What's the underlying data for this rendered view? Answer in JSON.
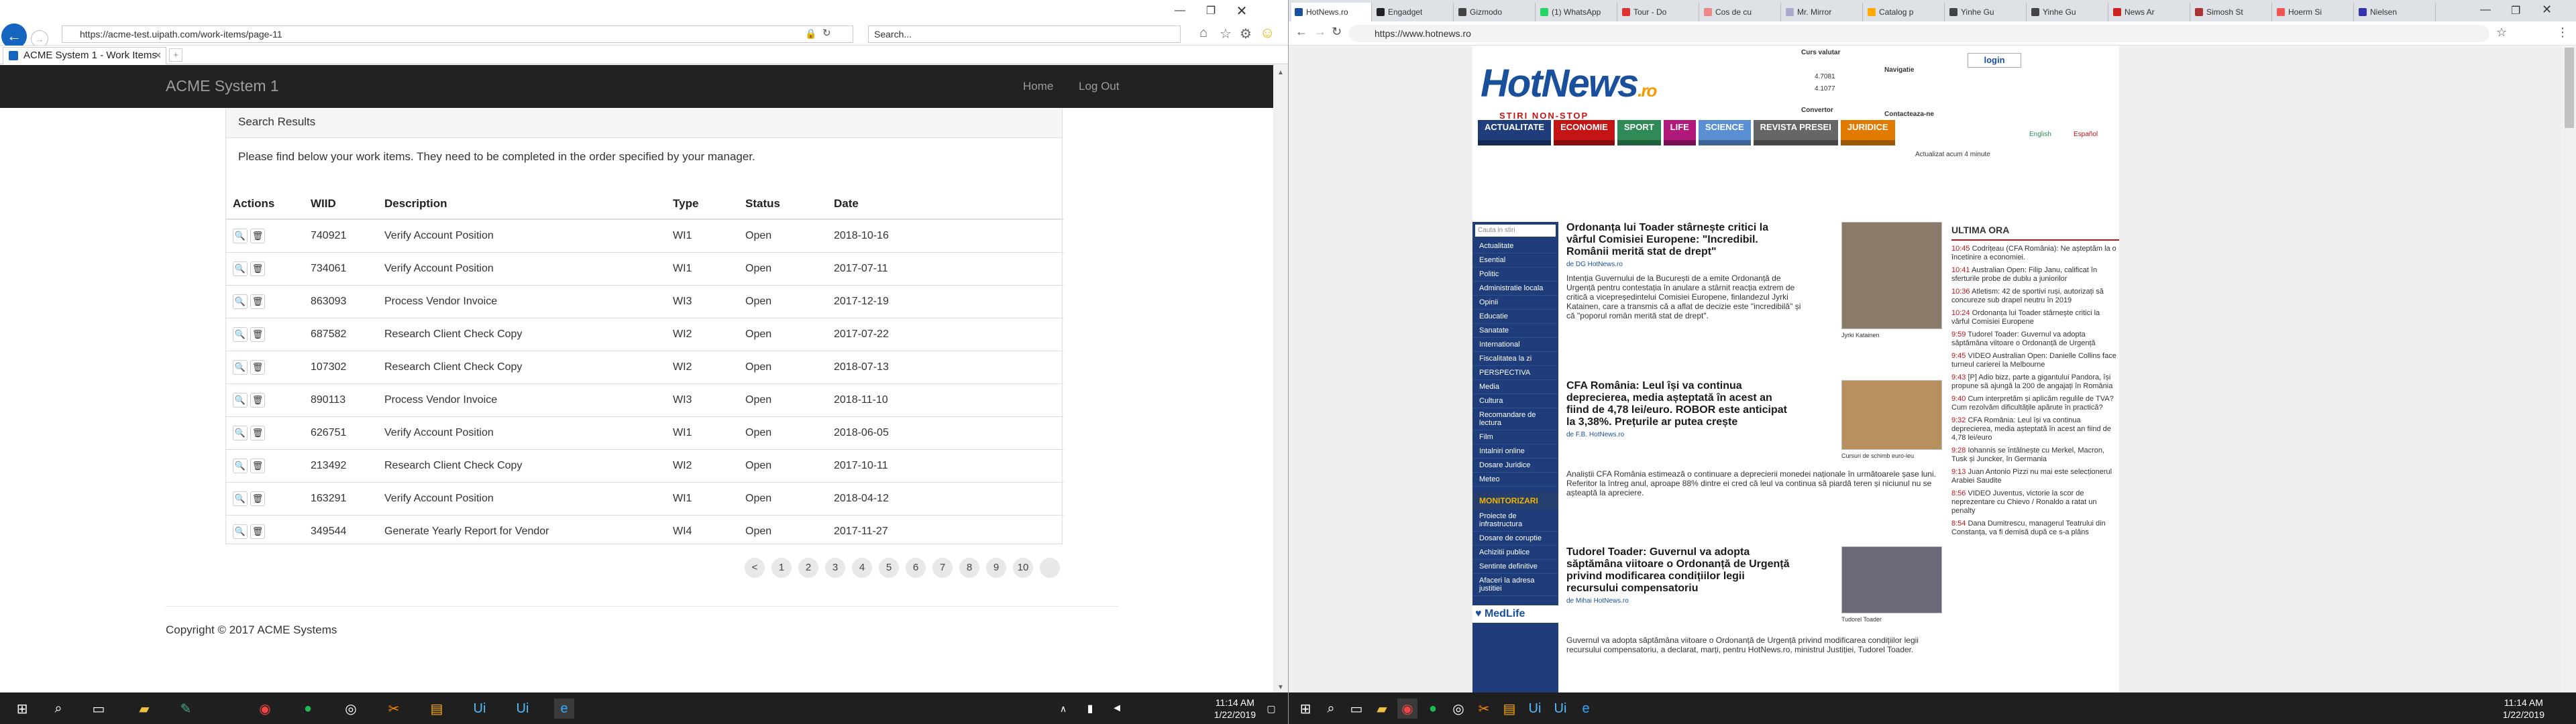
{
  "ie": {
    "url": "https://acme-test.uipath.com/work-items/page-11",
    "search_placeholder": "Search...",
    "tab_title": "ACME System 1 - Work Items",
    "app": {
      "brand": "ACME System 1",
      "nav_home": "Home",
      "nav_logout": "Log Out",
      "panel_title": "Search Results",
      "panel_message": "Please find below your work items. They need to be completed in the order specified by your manager.",
      "columns": [
        "Actions",
        "WIID",
        "Description",
        "Type",
        "Status",
        "Date"
      ],
      "rows": [
        {
          "wiid": "740921",
          "desc": "Verify Account Position",
          "type": "WI1",
          "status": "Open",
          "date": "2018-10-16"
        },
        {
          "wiid": "734061",
          "desc": "Verify Account Position",
          "type": "WI1",
          "status": "Open",
          "date": "2017-07-11"
        },
        {
          "wiid": "863093",
          "desc": "Process Vendor Invoice",
          "type": "WI3",
          "status": "Open",
          "date": "2017-12-19"
        },
        {
          "wiid": "687582",
          "desc": "Research Client Check Copy",
          "type": "WI2",
          "status": "Open",
          "date": "2017-07-22"
        },
        {
          "wiid": "107302",
          "desc": "Research Client Check Copy",
          "type": "WI2",
          "status": "Open",
          "date": "2018-07-13"
        },
        {
          "wiid": "890113",
          "desc": "Process Vendor Invoice",
          "type": "WI3",
          "status": "Open",
          "date": "2018-11-10"
        },
        {
          "wiid": "626751",
          "desc": "Verify Account Position",
          "type": "WI1",
          "status": "Open",
          "date": "2018-06-05"
        },
        {
          "wiid": "213492",
          "desc": "Research Client Check Copy",
          "type": "WI2",
          "status": "Open",
          "date": "2017-10-11"
        },
        {
          "wiid": "163291",
          "desc": "Verify Account Position",
          "type": "WI1",
          "status": "Open",
          "date": "2018-04-12"
        },
        {
          "wiid": "349544",
          "desc": "Generate Yearly Report for Vendor",
          "type": "WI4",
          "status": "Open",
          "date": "2017-11-27"
        }
      ],
      "pages": [
        "<",
        "1",
        "2",
        "3",
        "4",
        "5",
        "6",
        "7",
        "8",
        "9",
        "10",
        ""
      ],
      "footer": "Copyright © 2017 ACME Systems"
    },
    "clock": {
      "time": "11:14 AM",
      "date": "1/22/2019"
    }
  },
  "chrome": {
    "tabs": [
      {
        "label": "HotNews.ro",
        "color": "#1a4f9c"
      },
      {
        "label": "Engadget",
        "color": "#222"
      },
      {
        "label": "Gizmodo",
        "color": "#444"
      },
      {
        "label": "(1) WhatsApp",
        "color": "#25d366"
      },
      {
        "label": "Tour - Do",
        "color": "#d33"
      },
      {
        "label": "Cos de cu",
        "color": "#e88"
      },
      {
        "label": "Mr. Mirror",
        "color": "#aac"
      },
      {
        "label": "Catalog p",
        "color": "#fa0"
      },
      {
        "label": "Yinhe Gu",
        "color": "#444"
      },
      {
        "label": "Yinhe Gu",
        "color": "#444"
      },
      {
        "label": "News Ar",
        "color": "#c22"
      },
      {
        "label": "Simosh St",
        "color": "#a33"
      },
      {
        "label": "Hoerm Si",
        "color": "#e55"
      },
      {
        "label": "Nielsen",
        "color": "#33a"
      }
    ],
    "url": "https://www.hotnews.ro",
    "hotnews": {
      "logo_main": "HotNews",
      "logo_suffix": ".ro",
      "slogan": "STIRI NON-STOP",
      "curs_label": "Curs valutar",
      "rates": [
        "4.7081",
        "4.1077"
      ],
      "convertor": "Convertor",
      "login": "login",
      "navigatie": "Navigatie",
      "contact": "Contacteaza-ne",
      "nav": [
        {
          "label": "ACTUALITATE",
          "color": "#1e3d7a"
        },
        {
          "label": "ECONOMIE",
          "color": "#c41414"
        },
        {
          "label": "SPORT",
          "color": "#2e8b57"
        },
        {
          "label": "LIFE",
          "color": "#b0187a"
        },
        {
          "label": "SCIENCE",
          "color": "#5b8fd4"
        },
        {
          "label": "REVISTA PRESEI",
          "color": "#666"
        },
        {
          "label": "JURIDICE",
          "color": "#e07b00"
        }
      ],
      "lang_en": "English",
      "lang_es": "Español",
      "updated": "Actualizat acum 4 minute",
      "side_search": "Cauta in stiri",
      "side_items": [
        "Actualitate",
        "Esential",
        "Politic",
        "Administratie locala",
        "Opinii",
        "Educatie",
        "Sanatate",
        "International",
        "Fiscalitatea la zi",
        "PERSPECTIVA",
        "Media",
        "Cultura",
        "Recomandare de lectura",
        "Film",
        "Intalniri online",
        "Dosare Juridice",
        "Meteo"
      ],
      "side_head": "MONITORIZARI",
      "side_items2": [
        "Proiecte de infrastructura",
        "Dosare de coruptie",
        "Achizitii publice",
        "Sentinte definitive",
        "Afaceri la adresa justitiei"
      ],
      "medlife": "MedLife",
      "articles": [
        {
          "title": "Ordonanța lui Toader stârnește critici la vârful Comisiei Europene: \"Incredibil. Românii merită stat de drept\"",
          "meta": "de DG HotNews.ro",
          "text": "Intenția Guvernului de la București de a emite Ordonanță de Urgență pentru contestația în anulare a stârnit reacția extrem de critică a vicepreședintelui Comisiei Europene, finlandezul Jyrki Katainen, care a transmis că a aflat de decizie este \"incredibilă\" și că \"poporul român merită stat de drept\".",
          "caption": "Jyrki Katainen"
        },
        {
          "title": "CFA România: Leul își va continua deprecierea, media așteptată în acest an fiind de 4,78 lei/euro. ROBOR este anticipat la 3,38%. Prețurile ar putea crește",
          "meta": "de F.B. HotNews.ro",
          "text": "Analiștii CFA România estimează o continuare a deprecierii monedei naționale în următoarele șase luni. Referitor la întreg anul, aproape 88% dintre ei cred că leul va continua să piardă teren și niciunul nu se așteaptă la apreciere.",
          "caption": "Cursuri de schimb euro-leu"
        },
        {
          "title": "Tudorel Toader: Guvernul va adopta săptămâna viitoare o Ordonanță de Urgență privind modificarea condițiilor legii recursului compensatoriu",
          "meta": "de Mihai HotNews.ro",
          "text": "Guvernul va adopta săptămâna viitoare o Ordonanță de Urgență privind modificarea condițiilor legii recursului compensatoriu, a declarat, marți, pentru HotNews.ro, ministrul Justiției, Tudorel Toader.",
          "caption": "Tudorel Toader"
        }
      ],
      "ultima_ora": "ULTIMA ORA",
      "news": [
        {
          "time": "10:45",
          "text": "Codrițeau (CFA România): Ne așteptăm la o încetinire a economiei."
        },
        {
          "time": "10:41",
          "text": "Australian Open: Filip Janu, calificat în sferturile probe de dublu a juniorilor"
        },
        {
          "time": "10:36",
          "text": "Atletism: 42 de sportivi ruși, autorizați să concureze sub drapel neutru în 2019"
        },
        {
          "time": "10:24",
          "text": "Ordonanța lui Toader stârnește critici la vârful Comisiei Europene"
        },
        {
          "time": "9:59",
          "text": "Tudorel Toader: Guvernul va adopta săptămâna viitoare o Ordonanță de Urgență"
        },
        {
          "time": "9:45",
          "text": "VIDEO Australian Open: Danielle Collins face turneul carierei la Melbourne"
        },
        {
          "time": "9:43",
          "text": "[P] Adio bizz, parte a gigantului Pandora, își propune să ajungă la 200 de angajați în România"
        },
        {
          "time": "9:40",
          "text": "Cum interpretăm și aplicăm regulile de TVA? Cum rezolvăm dificultățile apărute în practică?"
        },
        {
          "time": "9:32",
          "text": "CFA România: Leul își va continua deprecierea, media așteptată în acest an fiind de 4,78 lei/euro"
        },
        {
          "time": "9:28",
          "text": "Iohannis se întâlnește cu Merkel, Macron, Tusk și Juncker, în Germania"
        },
        {
          "time": "9:13",
          "text": "Juan Antonio Pizzi nu mai este selecționerul Arabiei Saudite"
        },
        {
          "time": "8:56",
          "text": "VIDEO Juventus, victorie la scor de neprezentare cu Chievo / Ronaldo a ratat un penalty"
        },
        {
          "time": "8:54",
          "text": "Dana Dumitrescu, managerul Teatrului din Constanța, va fi demisă după ce s-a plâns"
        }
      ]
    },
    "clock": {
      "time": "11:14 AM",
      "date": "1/22/2019"
    }
  }
}
